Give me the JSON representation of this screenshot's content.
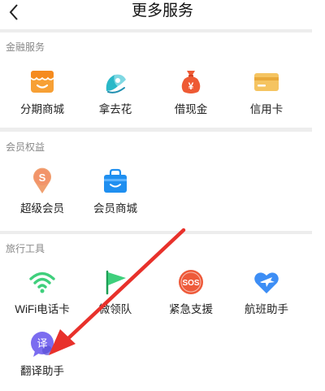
{
  "header": {
    "title": "更多服务"
  },
  "sections": [
    {
      "title": "金融服务",
      "items": [
        {
          "label": "分期商城",
          "icon": "store-icon"
        },
        {
          "label": "拿去花",
          "icon": "na-qu-hua-icon"
        },
        {
          "label": "借现金",
          "icon": "money-bag-icon"
        },
        {
          "label": "信用卡",
          "icon": "credit-card-icon"
        }
      ]
    },
    {
      "title": "会员权益",
      "items": [
        {
          "label": "超级会员",
          "icon": "super-member-icon"
        },
        {
          "label": "会员商城",
          "icon": "shopping-bag-icon"
        }
      ]
    },
    {
      "title": "旅行工具",
      "items": [
        {
          "label": "WiFi电话卡",
          "icon": "wifi-icon"
        },
        {
          "label": "微领队",
          "icon": "flag-icon"
        },
        {
          "label": "紧急支援",
          "icon": "sos-icon"
        },
        {
          "label": "航班助手",
          "icon": "flight-icon"
        },
        {
          "label": "翻译助手",
          "icon": "translate-icon",
          "icon_text": "译"
        }
      ]
    }
  ],
  "sos_text": "SOS",
  "colors": {
    "orange": "#f7a035",
    "teal": "#2ab8c8",
    "red": "#ee5a34",
    "gold": "#f5c461",
    "green": "#3fcf7c",
    "blue": "#3d8ef5",
    "purple": "#7b6cf0",
    "annotation_red": "#e8312b"
  }
}
